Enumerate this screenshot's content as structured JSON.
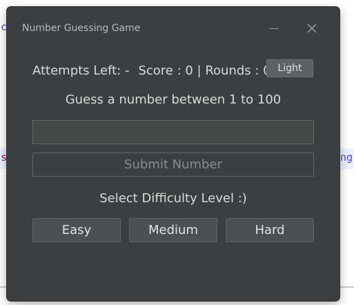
{
  "window": {
    "title": "Number Guessing Game",
    "minimize_icon": "minimize-icon",
    "close_icon": "close-icon"
  },
  "status": {
    "attempts": "Attempts Left: -",
    "score": "Score : 0 | Rounds : 0"
  },
  "theme_button": "Light",
  "prompt": "Guess a number between 1 to 100",
  "guess_input": {
    "value": "",
    "placeholder": ""
  },
  "submit_button": "Submit Number",
  "difficulty": {
    "label": "Select Difficulty Level :)",
    "options": [
      "Easy",
      "Medium",
      "Hard"
    ]
  },
  "background_fragments": {
    "left_top": "c",
    "left_mid": "s",
    "right_mid": "ng"
  },
  "colors": {
    "window_bg": "#3c3f41",
    "text": "#d8dadb",
    "button_bg": "#4c5052",
    "theme_button_bg": "#5d6163"
  }
}
